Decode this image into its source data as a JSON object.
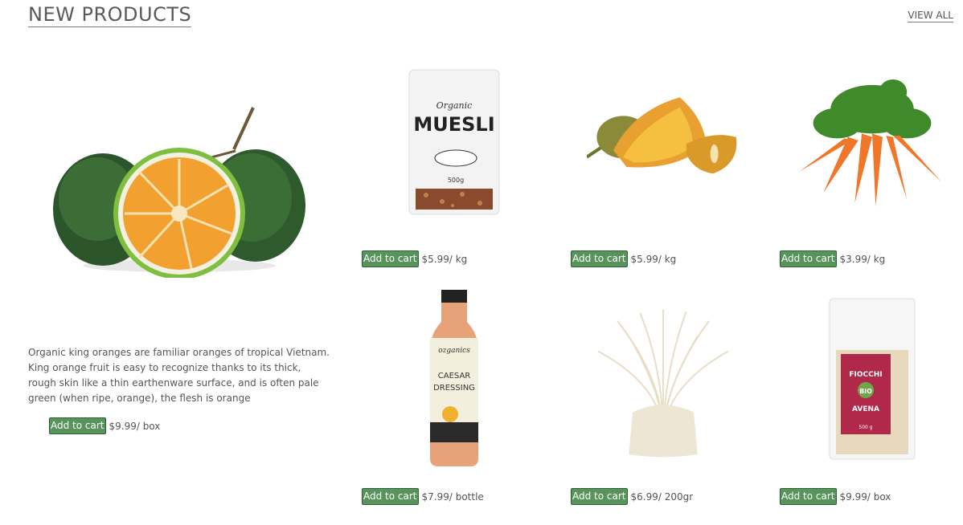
{
  "header": {
    "title": "NEW PRODUCTS",
    "view_all": "VIEW ALL"
  },
  "featured": {
    "description": "Organic king oranges are familiar oranges of tropical Vietnam. King orange fruit is easy to recognize thanks to its thick, rough skin like a thin earthenware surface, and is often pale green (when ripe, orange), the flesh is orange",
    "add_label": "Add to cart",
    "price": "$9.99/ box"
  },
  "products": [
    {
      "name": "muesli",
      "add_label": "Add to cart",
      "price": "$5.99/ kg"
    },
    {
      "name": "jackfruit",
      "add_label": "Add to cart",
      "price": "$5.99/ kg"
    },
    {
      "name": "carrots",
      "add_label": "Add to cart",
      "price": "$3.99/ kg"
    },
    {
      "name": "caesar-dressing",
      "add_label": "Add to cart",
      "price": "$7.99/ bottle"
    },
    {
      "name": "enoki-mushroom",
      "add_label": "Add to cart",
      "price": "$6.99/ 200gr"
    },
    {
      "name": "oat-flakes",
      "add_label": "Add to cart",
      "price": "$9.99/ box"
    }
  ],
  "product_labels": {
    "muesli_brand": "Organic",
    "muesli_name": "MUESLI",
    "muesli_weight": "500g",
    "dressing_brand": "ozganics",
    "dressing_line1": "CAESAR",
    "dressing_line2": "DRESSING",
    "oats_line1": "FIOCCHI",
    "oats_line2": "BIO",
    "oats_line3": "AVENA",
    "oats_weight": "500 g"
  },
  "colors": {
    "button_green": "#58935c",
    "text": "#555555"
  }
}
